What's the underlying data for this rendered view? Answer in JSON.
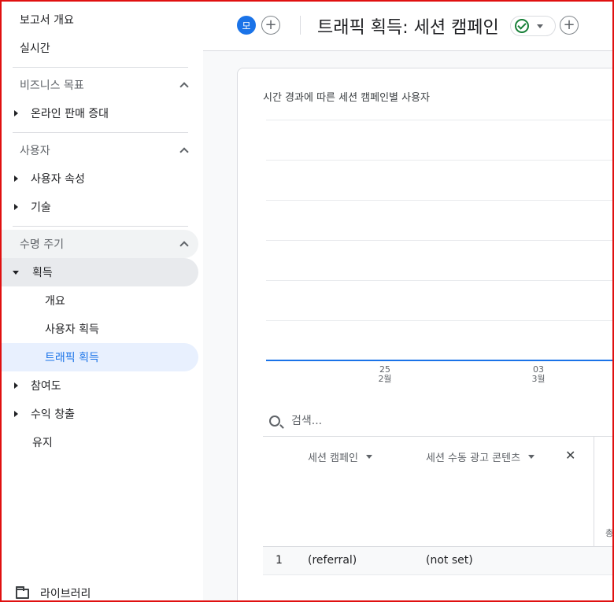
{
  "sidebar": {
    "report_overview": "보고서 개요",
    "realtime": "실시간",
    "business_goals": {
      "title": "비즈니스 목표",
      "items": [
        "온라인 판매 증대"
      ]
    },
    "user": {
      "title": "사용자",
      "items": [
        "사용자 속성",
        "기술"
      ]
    },
    "lifecycle": {
      "title": "수명 주기",
      "acquisition": "획득",
      "acquisition_children": [
        "개요",
        "사용자 획득",
        "트래픽 획득"
      ],
      "items_after": [
        "참여도",
        "수익 창출"
      ],
      "retention": "유지"
    },
    "library": "라이브러리"
  },
  "header": {
    "avatar_initial": "모",
    "title": "트래픽 획득: 세션 캠페인",
    "add_symbol": "+"
  },
  "chart": {
    "title": "시간 경과에 따른 세션 캠페인별 사용자",
    "ticks": [
      {
        "day": "25",
        "month": "2월"
      },
      {
        "day": "03",
        "month": "3월"
      }
    ]
  },
  "table": {
    "search_placeholder": "검색...",
    "col1": "세션 캠페인",
    "col2": "세션 수동 광고 콘텐츠",
    "close_symbol": "✕",
    "cut_label": "총",
    "rows": [
      {
        "index": "1",
        "campaign": "(referral)",
        "content": "(not set)"
      }
    ]
  },
  "colors": {
    "accent": "#1a73e8",
    "active_bg": "#e8f0fe",
    "success": "#188038",
    "frame": "#e01010"
  }
}
